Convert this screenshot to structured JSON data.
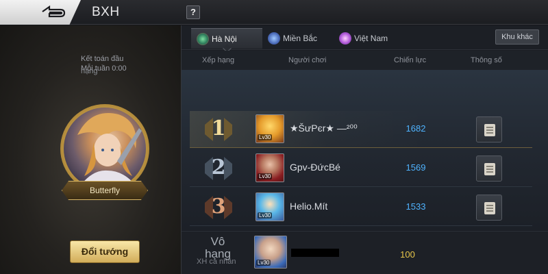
{
  "header": {
    "title": "BXH",
    "help_label": "?"
  },
  "left_panel": {
    "note_line1": "Kết toán đầu",
    "note_line2": "Mỗi tuần 0:00",
    "note_line3": "hạng",
    "hero_name": "Butterfly",
    "change_button": "Đổi tướng"
  },
  "tabs": [
    {
      "label": "Hà Nội",
      "active": true,
      "icon": "hanoi-region-icon"
    },
    {
      "label": "Miền Bắc",
      "active": false,
      "icon": "north-region-icon"
    },
    {
      "label": "Việt Nam",
      "active": false,
      "icon": "vietnam-region-icon"
    }
  ],
  "other_region_button": "Khu khác",
  "columns": {
    "rank": "Xếp hạng",
    "player": "Người chơi",
    "power": "Chiến lực",
    "stats": "Thông số"
  },
  "rows": [
    {
      "rank": "1",
      "name": "★ŠưPєr★ —²⁰⁰",
      "level": "Lv30",
      "power": "1682"
    },
    {
      "rank": "2",
      "name": "Gpv-ĐứcBé",
      "level": "Lv30",
      "power": "1569"
    },
    {
      "rank": "3",
      "name": "Helio.Mít",
      "level": "Lv30",
      "power": "1533"
    }
  ],
  "my_row": {
    "rank_line1": "Vô",
    "rank_line2": "hạng",
    "rank_label": "XH cá nhân",
    "level": "Lv30",
    "power": "100"
  },
  "colors": {
    "gold": "#d9b767",
    "power_blue": "#4fb3ff",
    "my_power_yellow": "#e9c74a"
  }
}
